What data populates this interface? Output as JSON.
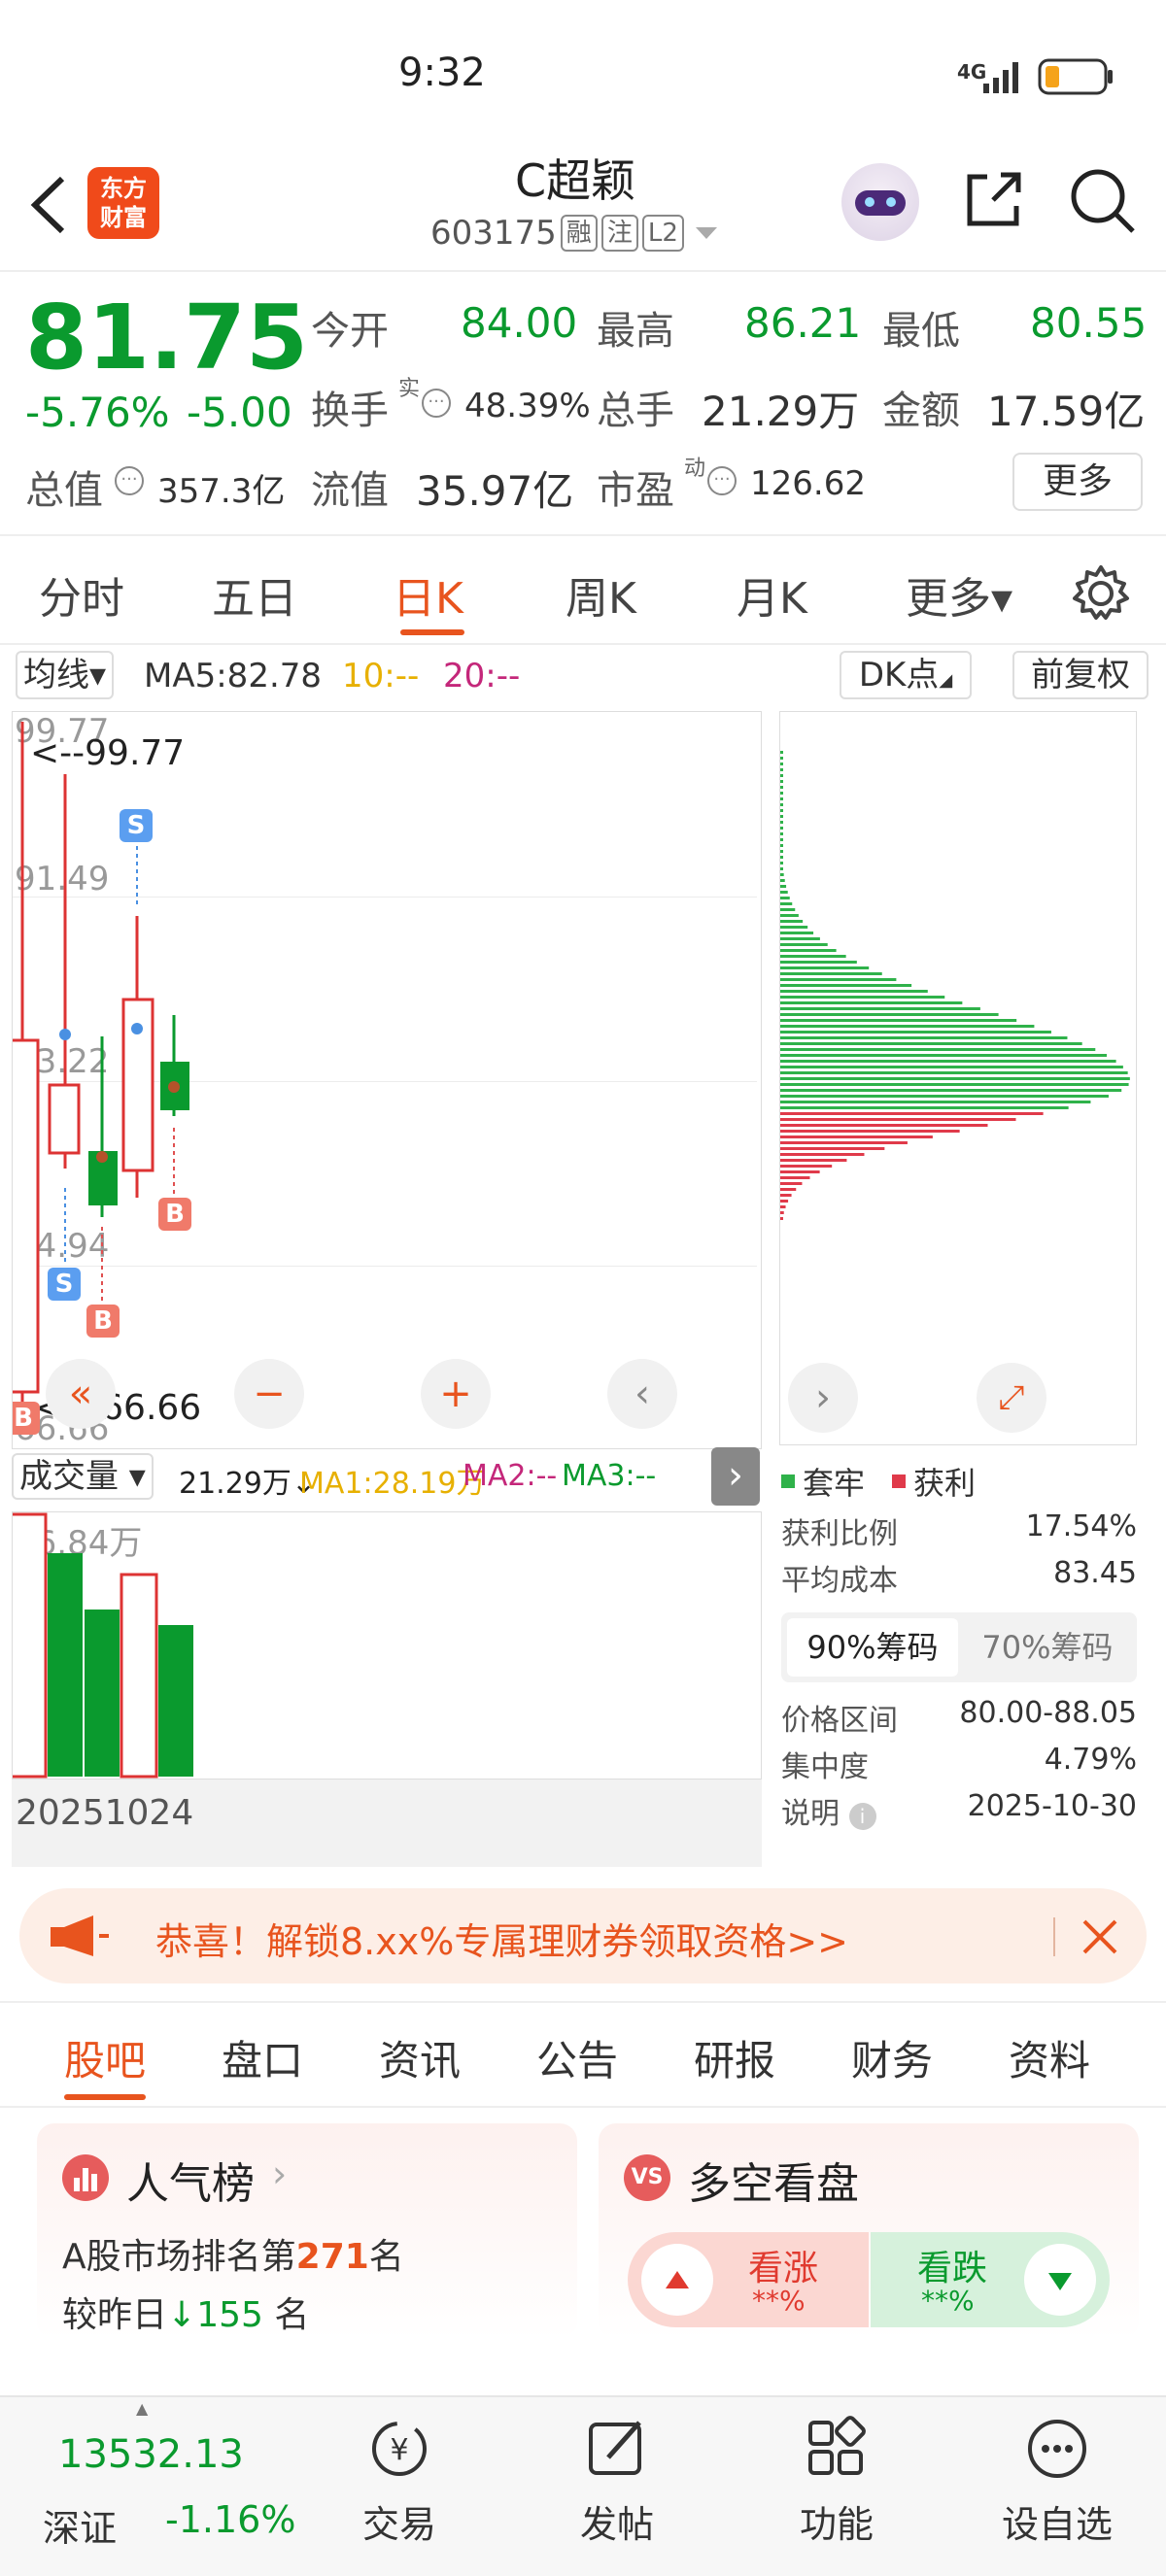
{
  "status": {
    "time": "9:32",
    "network": "4G"
  },
  "header": {
    "title": "C超颖",
    "code": "603175",
    "tags": [
      "融",
      "注",
      "L2"
    ],
    "logo": "东方\n财富"
  },
  "quote": {
    "price": "81.75",
    "change_pct": "-5.76%",
    "change": "-5.00",
    "open_label": "今开",
    "open": "84.00",
    "high_label": "最高",
    "high": "86.21",
    "low_label": "最低",
    "low": "80.55",
    "turnover_label": "换手",
    "turnover_sup": "实",
    "turnover": "48.39%",
    "volume_label": "总手",
    "volume": "21.29万",
    "amount_label": "金额",
    "amount": "17.59亿",
    "mcap_label": "总值",
    "mcap": "357.3亿",
    "float_label": "流值",
    "float": "35.97亿",
    "pe_label": "市盈",
    "pe_sup": "动",
    "pe": "126.62",
    "more": "更多"
  },
  "chart_tabs": [
    "分时",
    "五日",
    "日K",
    "周K",
    "月K",
    "更多▾"
  ],
  "ma_bar": {
    "selector": "均线▾",
    "ma5": "MA5:82.78",
    "ma10": "10:--",
    "ma20": "20:--",
    "dk": "DK点",
    "adjust": "前复权"
  },
  "kline": {
    "y_labels": [
      "99.77",
      "91.49",
      "83.22",
      "74.94",
      "66.66"
    ],
    "max_marker": "<--99.77",
    "min_marker": "<---66.66",
    "marks": [
      "S",
      "S",
      "B",
      "B",
      "B"
    ]
  },
  "volume_bar": {
    "selector": "成交量 ▾",
    "vol": "21.29万↓",
    "ma1": "MA1:28.19万",
    "ma2": "MA2:--",
    "ma3": "MA3:--",
    "top_label": "36.84万",
    "date": "20251024"
  },
  "chip": {
    "legend_trapped": "套牢",
    "legend_profit": "获利",
    "profit_ratio_label": "获利比例",
    "profit_ratio": "17.54%",
    "avg_cost_label": "平均成本",
    "avg_cost": "83.45",
    "tab90": "90%筹码",
    "tab70": "70%筹码",
    "range_label": "价格区间",
    "range": "80.00-88.05",
    "concentration_label": "集中度",
    "concentration": "4.79%",
    "note_label": "说明",
    "note_date": "2025-10-30"
  },
  "banner": {
    "text": "恭喜！解锁8.xx%专属理财券领取资格>>"
  },
  "info_tabs": [
    "股吧",
    "盘口",
    "资讯",
    "公告",
    "研报",
    "财务",
    "资料"
  ],
  "popularity": {
    "title": "人气榜",
    "rank_pre": "A股市场排名第",
    "rank": "271",
    "rank_post": "名",
    "cmp_pre": "较昨日",
    "cmp_val": "155",
    "cmp_post": "名"
  },
  "bullbear": {
    "title": "多空看盘",
    "up": "看涨",
    "up_val": "**%",
    "down": "看跌",
    "down_val": "**%"
  },
  "bottom_nav": {
    "index_value": "13532.13",
    "index_name": "深证",
    "index_change": "-1.16%",
    "trade": "交易",
    "post": "发帖",
    "func": "功能",
    "watch": "设自选"
  },
  "colors": {
    "accent": "#e8541e",
    "up": "#e03a2f",
    "down": "#0a9a2e"
  }
}
